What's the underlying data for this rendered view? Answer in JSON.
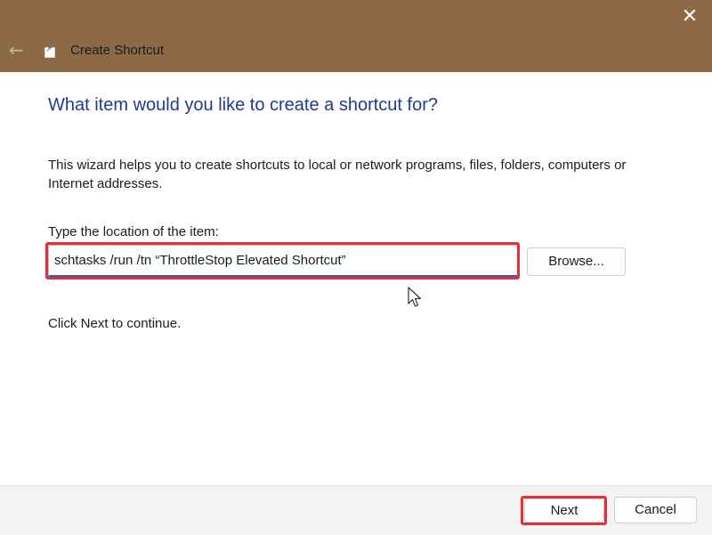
{
  "window": {
    "title": "Create Shortcut",
    "close_icon": "close-icon",
    "back_icon": "back-arrow-icon",
    "app_icon": "shortcut-icon",
    "titlebar_color": "#8c6a47"
  },
  "main": {
    "heading": "What item would you like to create a shortcut for?",
    "description": "This wizard helps you to create shortcuts to local or network programs, files, folders, computers or Internet addresses.",
    "location_label": "Type the location of the item:",
    "location_value": "schtasks /run /tn “ThrottleStop Elevated Shortcut”",
    "browse_label": "Browse...",
    "continue_text": "Click Next to continue.",
    "heading_color": "#1f3a93",
    "highlight_color": "#e0303c"
  },
  "footer": {
    "next_label": "Next",
    "cancel_label": "Cancel"
  }
}
